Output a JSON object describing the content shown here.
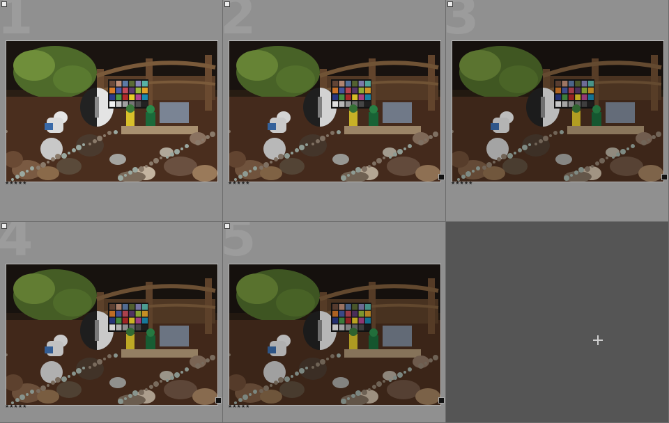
{
  "cells": [
    {
      "index": "1",
      "rating": "★★★★★",
      "edited": false,
      "brightness": 1.0
    },
    {
      "index": "2",
      "rating": "★★★★★",
      "edited": true,
      "brightness": 0.92
    },
    {
      "index": "3",
      "rating": "★★★★★",
      "edited": true,
      "brightness": 0.82
    },
    {
      "index": "4",
      "rating": "★★★★★",
      "edited": true,
      "brightness": 0.88
    },
    {
      "index": "5",
      "rating": "★★★★★",
      "edited": true,
      "brightness": 0.8
    }
  ],
  "empty_cell": {
    "icon": "plus-icon"
  },
  "colors": {
    "cell_bg": "#909090",
    "empty_bg": "#555555",
    "index_number": "#9c9c9c"
  }
}
